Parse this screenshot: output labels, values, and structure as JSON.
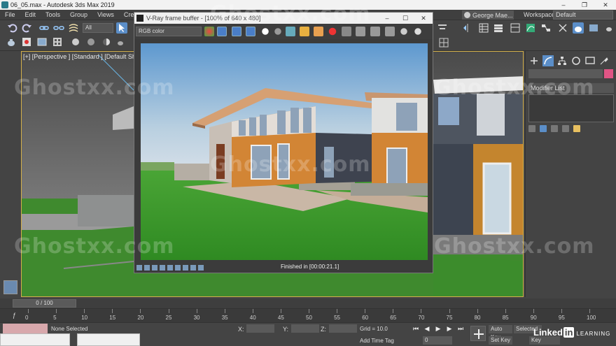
{
  "window": {
    "title": "06_05.max - Autodesk 3ds Max 2019",
    "controls": [
      "–",
      "❐",
      "✕"
    ]
  },
  "menu": {
    "items": [
      "File",
      "Edit",
      "Tools",
      "Group",
      "Views",
      "Cre"
    ],
    "user": "George Mae...",
    "workspaces_label": "Workspaces:",
    "workspaces_value": "Default"
  },
  "toolbar": {
    "selection_filter": "All"
  },
  "viewport": {
    "label": "[+] [Perspective ] [Standard ] [Default Shading ]"
  },
  "vfb": {
    "title": "V-Ray frame buffer - [100% of 640 x 480]",
    "channel": "RGB color",
    "status": "Finished in [00:00:21.1]",
    "controls": [
      "–",
      "☐",
      "✕"
    ]
  },
  "command_panel": {
    "modifier_list": "Modifier List"
  },
  "timeline": {
    "frame": "0 / 100",
    "ticks": [
      "0",
      "5",
      "10",
      "15",
      "20",
      "25",
      "30",
      "35",
      "40",
      "45",
      "50",
      "55",
      "60",
      "65",
      "70",
      "75",
      "80",
      "85",
      "90",
      "95",
      "100"
    ]
  },
  "status": {
    "selection": "None Selected",
    "x_label": "X:",
    "y_label": "Y:",
    "z_label": "Z:",
    "grid": "Grid = 10.0",
    "add_time_tag": "Add Time Tag",
    "auto_key": "Auto Key",
    "set_key": "Set Key",
    "selected": "Selected",
    "key_filters": "Key Filters...",
    "frame_value": "0"
  },
  "branding": {
    "linkedin": "Linked",
    "linkedin_in": "in",
    "learning": "LEARNING",
    "watermark": "Ghostxx.com"
  },
  "colors": {
    "accent_blue": "#4aa0e0",
    "object_color": "#e05585",
    "viewport_border": "#d4b04a"
  }
}
